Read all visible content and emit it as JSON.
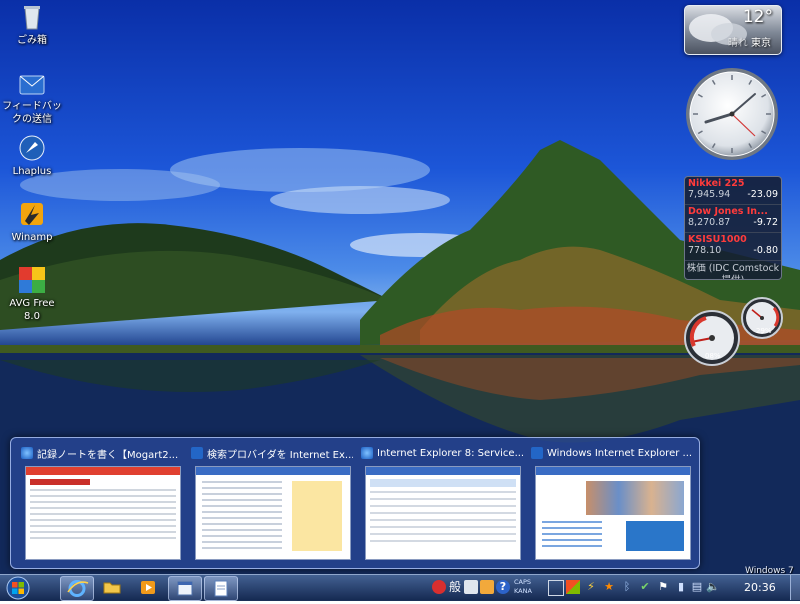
{
  "desktop": {
    "icons": [
      {
        "label": "ごみ箱",
        "icon": "recycle-bin-icon"
      },
      {
        "label": "フィードバックの送信",
        "icon": "feedback-icon"
      },
      {
        "label": "Lhaplus",
        "icon": "lhaplus-icon"
      },
      {
        "label": "Winamp",
        "icon": "winamp-icon"
      },
      {
        "label": "AVG Free 8.0",
        "icon": "avg-icon"
      }
    ],
    "watermark": "Windows 7"
  },
  "gadgets": {
    "weather": {
      "temp": "12°",
      "city": "東京",
      "prefix": "晴れ"
    },
    "stocks": {
      "items": [
        {
          "name": "Nikkei 225",
          "value": "7,945.94",
          "change": "-23.09"
        },
        {
          "name": "Dow Jones In...",
          "value": "8,270.87",
          "change": "-9.72"
        },
        {
          "name": "KSISU1000",
          "value": "778.10",
          "change": "-0.80"
        }
      ],
      "credit": "株価 (IDC Comstock 提供)"
    },
    "meters": {
      "cpu": "08%",
      "memory": "29%",
      "cpu_fraction": 0.08,
      "memory_fraction": 0.29
    }
  },
  "peek": {
    "thumbnails": [
      {
        "title": "記録ノートを書く【Mogart2...",
        "icon": "ie-icon"
      },
      {
        "title": "検索プロバイダを Internet Ex...",
        "icon": "windows-live-icon"
      },
      {
        "title": "Internet Explorer 8: Service...",
        "icon": "ie-icon"
      },
      {
        "title": "Windows Internet Explorer ...",
        "icon": "windows-live-icon"
      }
    ]
  },
  "taskbar": {
    "clock": "20:36",
    "caps": "CAPS",
    "kana": "KANA",
    "ime": "般",
    "colors": {
      "accent": "#2a4f9a",
      "highlight": "#8fa6cc"
    }
  }
}
